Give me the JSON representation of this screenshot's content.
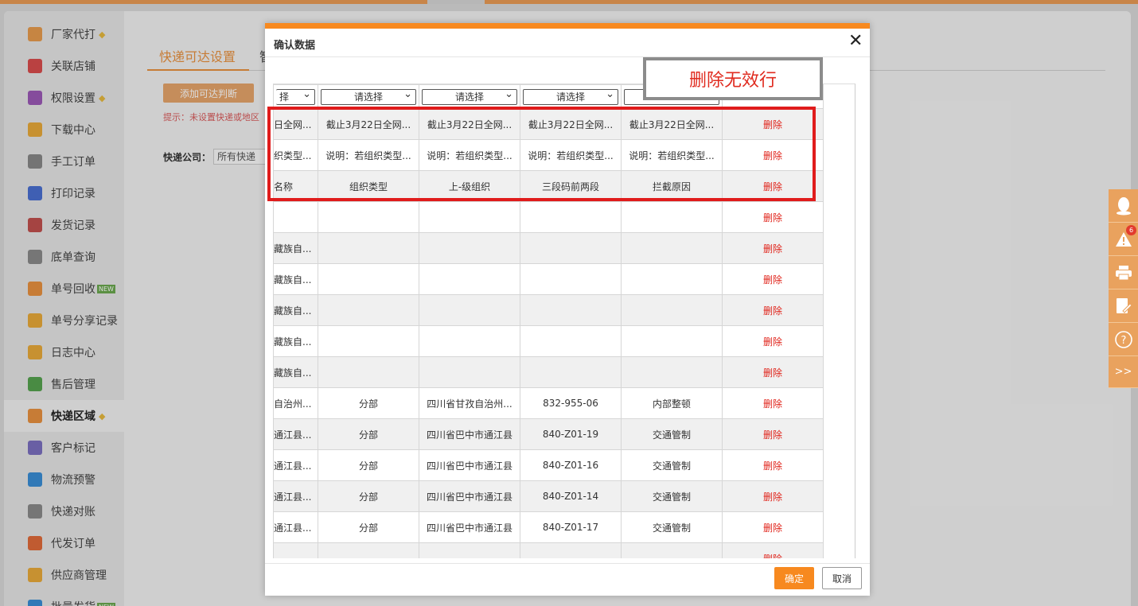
{
  "sidebar": {
    "items": [
      {
        "label": "厂家代打",
        "icon": "printer-icon",
        "color": "#e79b4d",
        "diamond": true
      },
      {
        "label": "关联店铺",
        "icon": "dice-icon",
        "color": "#d94c4c"
      },
      {
        "label": "权限设置",
        "icon": "lock-icon",
        "color": "#9b59b6",
        "diamond": true
      },
      {
        "label": "下载中心",
        "icon": "download-icon",
        "color": "#e8a93a"
      },
      {
        "label": "手工订单",
        "icon": "manual-order-icon",
        "color": "#888888"
      },
      {
        "label": "打印记录",
        "icon": "print-record-icon",
        "color": "#4a6fd1"
      },
      {
        "label": "发货记录",
        "icon": "ship-record-icon",
        "color": "#c0504d"
      },
      {
        "label": "底单查询",
        "icon": "barcode-icon",
        "color": "#8a8a8a"
      },
      {
        "label": "单号回收",
        "icon": "recycle-icon",
        "color": "#e8913f",
        "badge": "NEW"
      },
      {
        "label": "单号分享记录",
        "icon": "share-icon",
        "color": "#e8a93a"
      },
      {
        "label": "日志中心",
        "icon": "log-icon",
        "color": "#e8a93a"
      },
      {
        "label": "售后管理",
        "icon": "after-sale-icon",
        "color": "#55a24f"
      },
      {
        "label": "快递区域",
        "icon": "home-icon",
        "color": "#e8913f",
        "diamond": true,
        "active": true
      },
      {
        "label": "客户标记",
        "icon": "customer-icon",
        "color": "#7b6fbf"
      },
      {
        "label": "物流预警",
        "icon": "logistics-icon",
        "color": "#3a8dd6"
      },
      {
        "label": "快递对账",
        "icon": "reconcile-icon",
        "color": "#8a8a8a"
      },
      {
        "label": "代发订单",
        "icon": "dropship-icon",
        "color": "#e06a3a"
      },
      {
        "label": "供应商管理",
        "icon": "supplier-icon",
        "color": "#e8a93a"
      },
      {
        "label": "批量发货",
        "icon": "batch-ship-icon",
        "color": "#3a8dd6",
        "badge": "NEW"
      }
    ]
  },
  "main": {
    "tab_active": "快递可达设置",
    "tab_next": "智",
    "add_button": "添加可达判断",
    "hint": "提示：未设置快递或地区",
    "company_label": "快递公司：",
    "company_value": "所有快递"
  },
  "right_toolbar": {
    "badge": "6",
    "more": ">>"
  },
  "modal": {
    "title": "确认数据",
    "close": "✕",
    "callout": "删除无效行",
    "ok": "确定",
    "cancel": "取消",
    "header_selects": [
      "择",
      "请选择",
      "请选择",
      "请选择",
      ""
    ],
    "rows": [
      {
        "cells": [
          "日全网...",
          "截止3月22日全网...",
          "截止3月22日全网...",
          "截止3月22日全网...",
          "截止3月22日全网..."
        ],
        "action": "删除"
      },
      {
        "cells": [
          "织类型...",
          "说明：若组织类型...",
          "说明：若组织类型...",
          "说明：若组织类型...",
          "说明：若组织类型..."
        ],
        "action": "删除"
      },
      {
        "cells": [
          "名称",
          "组织类型",
          "上-级组织",
          "三段码前两段",
          "拦截原因"
        ],
        "action": "删除"
      },
      {
        "cells": [
          "",
          "",
          "",
          "",
          ""
        ],
        "action": "删除"
      },
      {
        "cells": [
          "藏族自...",
          "",
          "",
          "",
          ""
        ],
        "action": "删除"
      },
      {
        "cells": [
          "藏族自...",
          "",
          "",
          "",
          ""
        ],
        "action": "删除"
      },
      {
        "cells": [
          "藏族自...",
          "",
          "",
          "",
          ""
        ],
        "action": "删除"
      },
      {
        "cells": [
          "藏族自...",
          "",
          "",
          "",
          ""
        ],
        "action": "删除"
      },
      {
        "cells": [
          "藏族自...",
          "",
          "",
          "",
          ""
        ],
        "action": "删除"
      },
      {
        "cells": [
          "自治州...",
          "分部",
          "四川省甘孜自治州...",
          "832-955-06",
          "内部整顿"
        ],
        "action": "删除"
      },
      {
        "cells": [
          "通江县...",
          "分部",
          "四川省巴中市通江县",
          "840-Z01-19",
          "交通管制"
        ],
        "action": "删除"
      },
      {
        "cells": [
          "通江县...",
          "分部",
          "四川省巴中市通江县",
          "840-Z01-16",
          "交通管制"
        ],
        "action": "删除"
      },
      {
        "cells": [
          "通江县...",
          "分部",
          "四川省巴中市通江县",
          "840-Z01-14",
          "交通管制"
        ],
        "action": "删除"
      },
      {
        "cells": [
          "通江县...",
          "分部",
          "四川省巴中市通江县",
          "840-Z01-17",
          "交通管制"
        ],
        "action": "删除"
      },
      {
        "cells": [
          "",
          "",
          "",
          "",
          ""
        ],
        "action": "删除"
      }
    ]
  }
}
